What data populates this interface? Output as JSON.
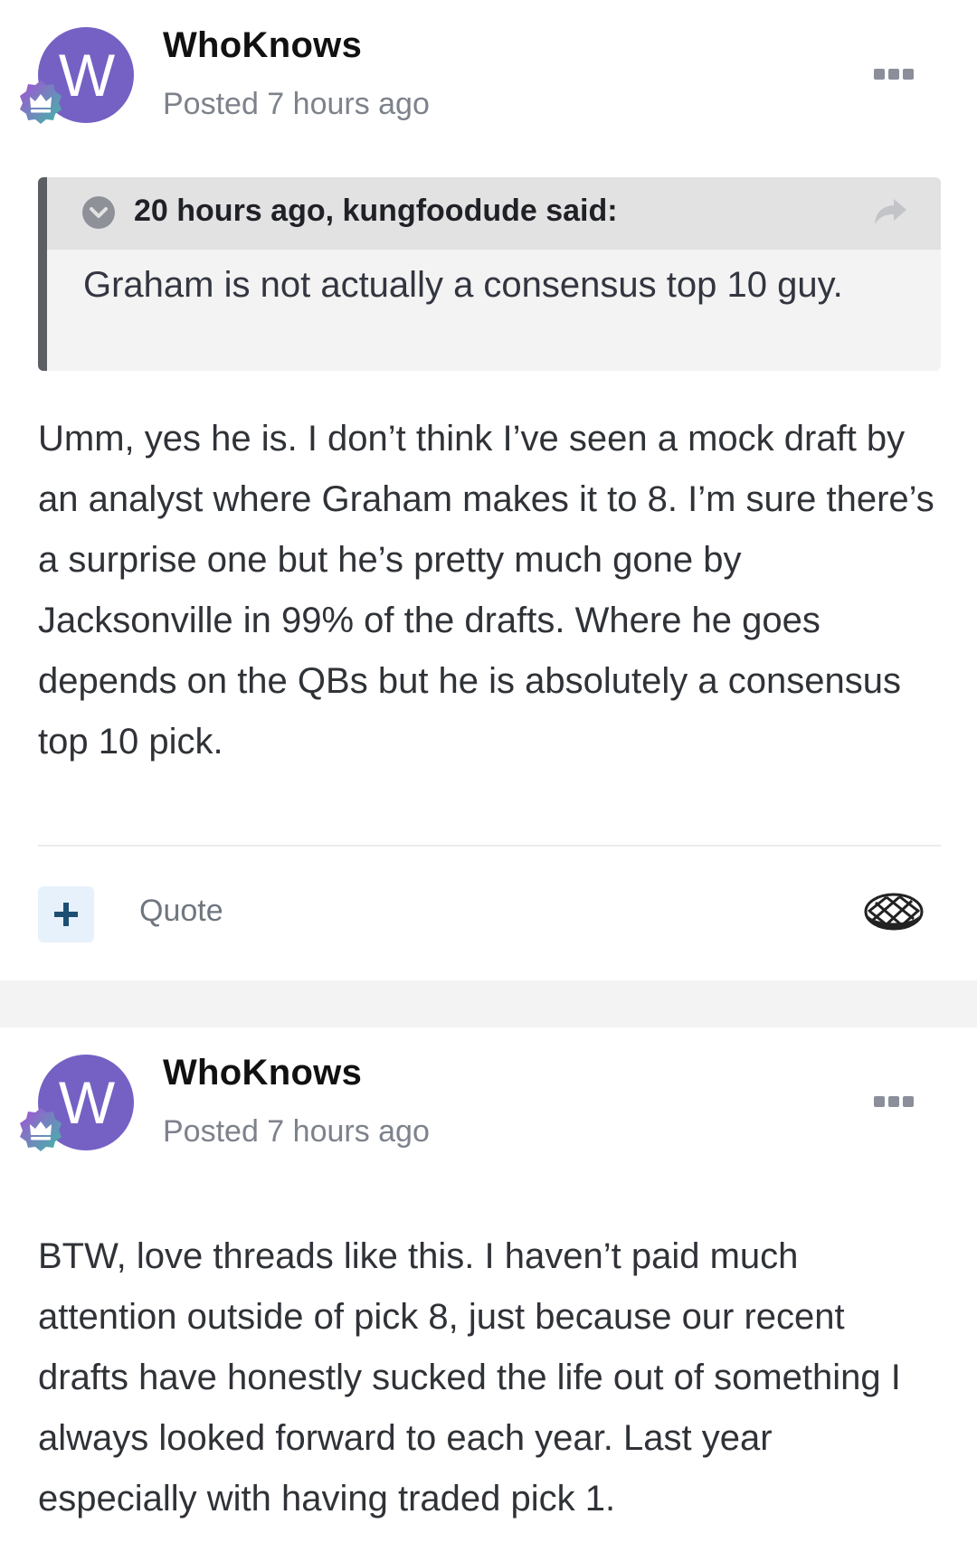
{
  "posts": [
    {
      "avatar_letter": "W",
      "author": "WhoKnows",
      "posted": "Posted 7 hours ago",
      "quote": {
        "citation": "20 hours ago, kungfoodude said:",
        "text": "Graham is not actually a consensus top 10 guy."
      },
      "body": "Umm, yes he is. I don’t think I’ve seen a mock draft by an analyst where Graham makes it to 8. I’m sure there’s a surprise one but he’s pretty much gone by Jacksonville in 99% of the drafts. Where he goes depends on the QBs but he is absolutely a consensus top 10 pick.",
      "actions": {
        "react_label": "+",
        "quote_label": "Quote"
      }
    },
    {
      "avatar_letter": "W",
      "author": "WhoKnows",
      "posted": "Posted 7 hours ago",
      "body": "BTW, love threads like this. I haven’t paid much attention outside of pick 8, just because our recent drafts have honestly sucked the life out of something I always looked forward to each year. Last year especially with having traded pick 1."
    }
  ],
  "colors": {
    "avatar": "#7561c4",
    "react_button_bg": "#e6f1fb",
    "react_plus": "#1d4f73",
    "quote_border": "#5b5e63"
  },
  "icons": {
    "badge": "crown-badge-icon",
    "more": "ellipsis-icon",
    "quote_toggle": "chevron-down-icon",
    "quote_share": "share-arrow-icon",
    "reaction": "pie-reaction-icon"
  }
}
